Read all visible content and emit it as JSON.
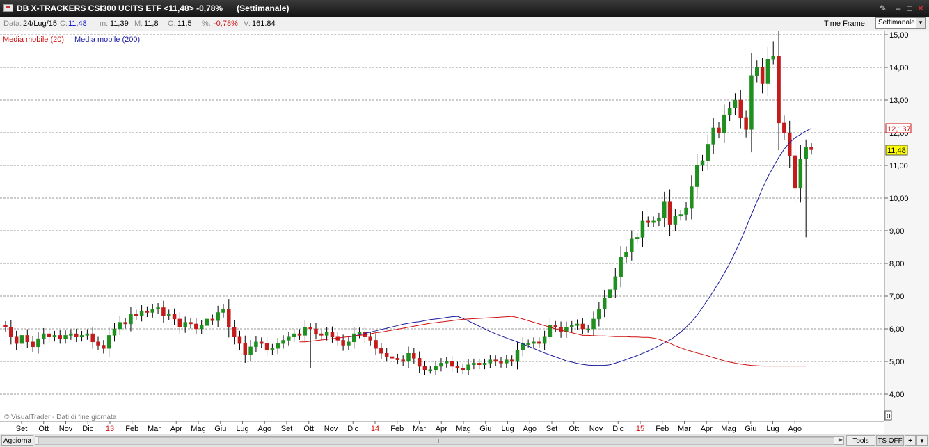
{
  "window": {
    "title": "DB X-TRACKERS CSI300 UCITS ETF <11,48> -0,78%",
    "period_label": "(Settimanale)"
  },
  "infobar": {
    "data_label": "Data:",
    "data_value": "24/Lug/15",
    "c_label": "C:",
    "c_value": "11,48",
    "m_label": "m:",
    "m_value": "11,39",
    "M_label": "M:",
    "M_value": "11,8",
    "o_label": "O:",
    "o_value": "11,5",
    "pct_label": "%:",
    "pct_value": "-0,78%",
    "v_label": "V:",
    "v_value": "161.84",
    "timeframe_label": "Time Frame",
    "timeframe_value": "Settimanale"
  },
  "legend": {
    "ma20": "Media mobile (20)",
    "ma200": "Media mobile (200)"
  },
  "footer": {
    "watermark": "© VisualTrader - Dati di fine giornata",
    "update_button": "Aggiorna",
    "tools_button": "Tools",
    "ts_button": "TS OFF",
    "plus_button": "+",
    "volume_box": "0"
  },
  "colors": {
    "up": "#1f8f1f",
    "down": "#c41b1b",
    "ma20": "#d01010",
    "ma200": "#1a1a9c",
    "last_price_bg": "#ffff00",
    "ma_value_color": "#d01010"
  },
  "chart_data": {
    "type": "candlestick",
    "ylim": [
      4.0,
      15.0
    ],
    "y_ticks": [
      "15,00",
      "14,00",
      "13,00",
      "12,00",
      "11,00",
      "10,00",
      "9,00",
      "8,00",
      "7,00",
      "6,00",
      "5,00",
      "4,00"
    ],
    "x_labels": [
      "Set",
      "Ott",
      "Nov",
      "Dic",
      "13",
      "Feb",
      "Mar",
      "Apr",
      "Mag",
      "Giu",
      "Lug",
      "Ago",
      "Set",
      "Ott",
      "Nov",
      "Dic",
      "14",
      "Feb",
      "Mar",
      "Apr",
      "Mag",
      "Giu",
      "Lug",
      "Ago",
      "Set",
      "Ott",
      "Nov",
      "Dic",
      "15",
      "Feb",
      "Mar",
      "Apr",
      "Mag",
      "Giu",
      "Lug",
      "Ago"
    ],
    "year_labels": [
      "13",
      "14",
      "15"
    ],
    "last_price": "11,48",
    "ma_last_value": "12,137",
    "closes": [
      6.05,
      5.75,
      5.55,
      5.8,
      5.6,
      5.45,
      5.7,
      5.85,
      5.75,
      5.8,
      5.7,
      5.8,
      5.85,
      5.75,
      5.8,
      5.85,
      5.6,
      5.5,
      5.4,
      5.8,
      6.0,
      6.2,
      6.15,
      6.45,
      6.4,
      6.55,
      6.5,
      6.6,
      6.65,
      6.4,
      6.45,
      6.3,
      6.05,
      6.2,
      6.15,
      6.0,
      6.1,
      6.3,
      6.25,
      6.5,
      6.6,
      6.05,
      5.75,
      5.55,
      5.2,
      5.45,
      5.6,
      5.55,
      5.35,
      5.4,
      5.55,
      5.65,
      5.75,
      5.85,
      5.8,
      6.05,
      6.0,
      5.85,
      5.8,
      5.9,
      5.75,
      5.65,
      5.5,
      5.6,
      5.85,
      5.9,
      5.75,
      5.65,
      5.4,
      5.25,
      5.15,
      5.1,
      5.05,
      5.0,
      5.25,
      5.1,
      4.85,
      4.75,
      4.75,
      4.85,
      4.95,
      5.0,
      4.85,
      4.8,
      4.75,
      4.9,
      4.95,
      4.9,
      4.95,
      5.05,
      5.0,
      4.95,
      5.05,
      5.0,
      5.35,
      5.55,
      5.55,
      5.6,
      5.55,
      5.75,
      6.1,
      6.05,
      5.9,
      6.05,
      6.1,
      6.15,
      6.0,
      6.0,
      6.3,
      6.6,
      6.95,
      7.2,
      7.6,
      8.2,
      8.35,
      8.75,
      8.8,
      9.3,
      9.25,
      9.3,
      9.4,
      9.9,
      9.2,
      9.45,
      9.5,
      9.7,
      10.35,
      11.0,
      11.15,
      11.65,
      12.15,
      12.0,
      12.55,
      12.75,
      13.0,
      12.45,
      12.1,
      13.75,
      14.0,
      13.5,
      14.25,
      14.35,
      12.3,
      12.0,
      11.3,
      10.3,
      11.2,
      11.55,
      11.48
    ],
    "ma20": [
      5.6,
      5.6,
      5.62,
      5.64,
      5.66,
      5.68,
      5.7,
      5.72,
      5.74,
      5.76,
      5.78,
      5.8,
      5.82,
      5.85,
      5.88,
      5.9,
      5.93,
      5.96,
      5.99,
      6.02,
      6.05,
      6.08,
      6.11,
      6.14,
      6.17,
      6.19,
      6.21,
      6.23,
      6.25,
      6.27,
      6.29,
      6.3,
      6.31,
      6.32,
      6.33,
      6.34,
      6.35,
      6.36,
      6.37,
      6.38,
      6.35,
      6.3,
      6.25,
      6.2,
      6.15,
      6.1,
      6.05,
      6.0,
      5.96,
      5.92,
      5.88,
      5.84,
      5.8,
      5.8,
      5.79,
      5.78,
      5.78,
      5.77,
      5.76,
      5.76,
      5.76,
      5.75,
      5.75,
      5.74,
      5.74,
      5.72,
      5.68,
      5.62,
      5.56,
      5.48,
      5.42,
      5.36,
      5.31,
      5.26,
      5.22,
      5.17,
      5.12,
      5.07,
      5.02,
      4.98,
      4.95,
      4.92,
      4.9,
      4.88,
      4.87,
      4.86,
      4.86,
      4.86,
      4.86,
      4.86,
      4.86,
      4.86,
      4.86,
      4.86
    ],
    "ma200": [
      5.75,
      5.78,
      5.82,
      5.86,
      5.9,
      5.94,
      5.98,
      6.02,
      6.06,
      6.1,
      6.14,
      6.17,
      6.2,
      6.22,
      6.25,
      6.28,
      6.3,
      6.32,
      6.35,
      6.37,
      6.38,
      6.32,
      6.24,
      6.16,
      6.08,
      6.0,
      5.92,
      5.85,
      5.78,
      5.72,
      5.66,
      5.6,
      5.54,
      5.47,
      5.4,
      5.33,
      5.26,
      5.2,
      5.14,
      5.08,
      5.02,
      4.98,
      4.94,
      4.91,
      4.89,
      4.88,
      4.88,
      4.88,
      4.9,
      4.95,
      5.0,
      5.06,
      5.12,
      5.18,
      5.25,
      5.32,
      5.4,
      5.48,
      5.57,
      5.66,
      5.77,
      5.9,
      6.05,
      6.22,
      6.42,
      6.65,
      6.9,
      7.15,
      7.42,
      7.7,
      8.0,
      8.35,
      8.7,
      9.1,
      9.5,
      9.9,
      10.3,
      10.65,
      10.95,
      11.25,
      11.5,
      11.7,
      11.85,
      11.95,
      12.05,
      12.137
    ]
  }
}
